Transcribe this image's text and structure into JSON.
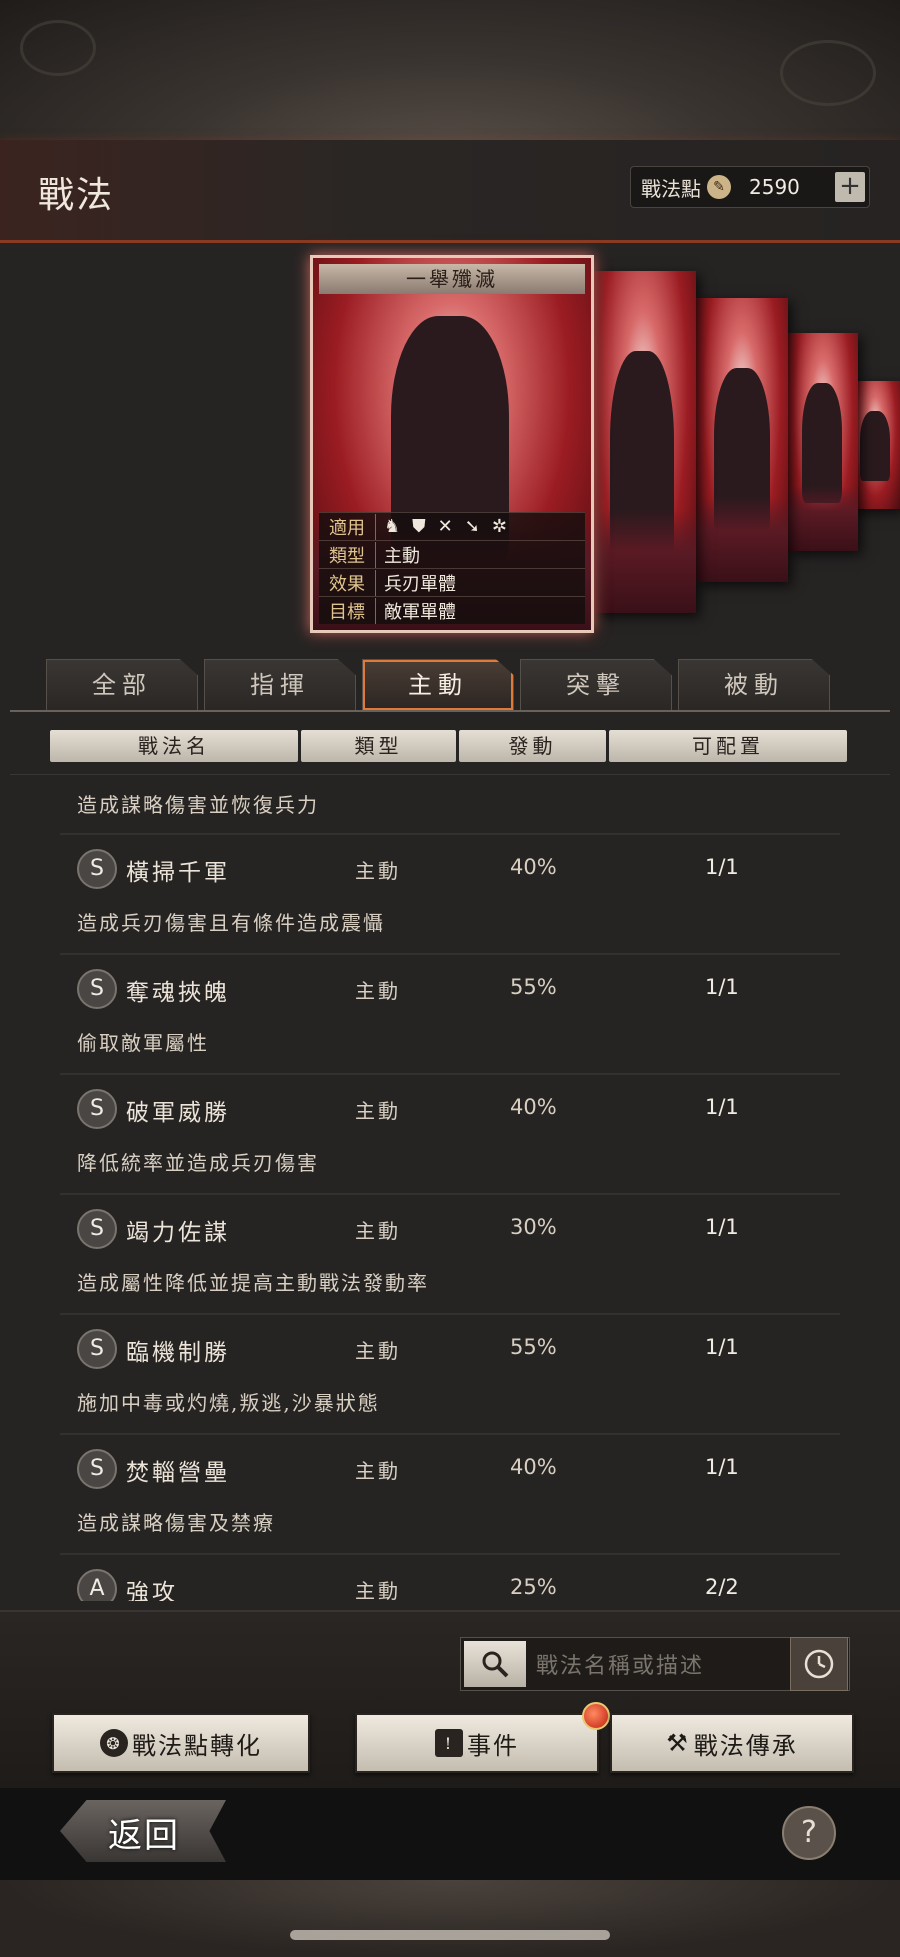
{
  "header": {
    "title": "戰法",
    "points_label": "戰法點",
    "points_value": "2590",
    "plus_label": "+"
  },
  "card": {
    "name": "一舉殲滅",
    "rows": [
      {
        "key": "適用",
        "value": ""
      },
      {
        "key": "類型",
        "value": "主動"
      },
      {
        "key": "效果",
        "value": "兵刃單體"
      },
      {
        "key": "目標",
        "value": "敵軍單體"
      }
    ],
    "applicable_icons": [
      "cavalry-icon",
      "shield-icon",
      "bow-icon",
      "spear-icon",
      "wheel-icon"
    ],
    "background_color": "#9a1c22"
  },
  "tabs": [
    {
      "label": "全部",
      "active": false
    },
    {
      "label": "指揮",
      "active": false
    },
    {
      "label": "主動",
      "active": true
    },
    {
      "label": "突擊",
      "active": false
    },
    {
      "label": "被動",
      "active": false
    }
  ],
  "table": {
    "headers": [
      "戰法名",
      "類型",
      "發動",
      "可配置"
    ],
    "partial_top_desc": "造成謀略傷害並恢復兵力",
    "rows": [
      {
        "grade": "S",
        "name": "橫掃千軍",
        "type": "主動",
        "rate": "40%",
        "slots": "1/1",
        "desc": "造成兵刃傷害且有條件造成震懾"
      },
      {
        "grade": "S",
        "name": "奪魂挾魄",
        "type": "主動",
        "rate": "55%",
        "slots": "1/1",
        "desc": "偷取敵軍屬性"
      },
      {
        "grade": "S",
        "name": "破軍威勝",
        "type": "主動",
        "rate": "40%",
        "slots": "1/1",
        "desc": "降低統率並造成兵刃傷害"
      },
      {
        "grade": "S",
        "name": "竭力佐謀",
        "type": "主動",
        "rate": "30%",
        "slots": "1/1",
        "desc": "造成屬性降低並提高主動戰法發動率"
      },
      {
        "grade": "S",
        "name": "臨機制勝",
        "type": "主動",
        "rate": "55%",
        "slots": "1/1",
        "desc": "施加中毒或灼燒,叛逃,沙暴狀態"
      },
      {
        "grade": "S",
        "name": "焚輜營壘",
        "type": "主動",
        "rate": "40%",
        "slots": "1/1",
        "desc": "造成謀略傷害及禁療"
      },
      {
        "grade": "A",
        "name": "強攻",
        "type": "主動",
        "rate": "25%",
        "slots": "2/2",
        "desc": ""
      }
    ]
  },
  "search": {
    "placeholder": "戰法名稱或描述"
  },
  "actions": {
    "convert_label": "戰法點轉化",
    "event_label": "事件",
    "inherit_label": "戰法傳承"
  },
  "footer": {
    "back_label": "返回",
    "help_label": "?"
  },
  "colors": {
    "accent_orange": "#e07a3a",
    "notification_red": "#c01e10"
  }
}
